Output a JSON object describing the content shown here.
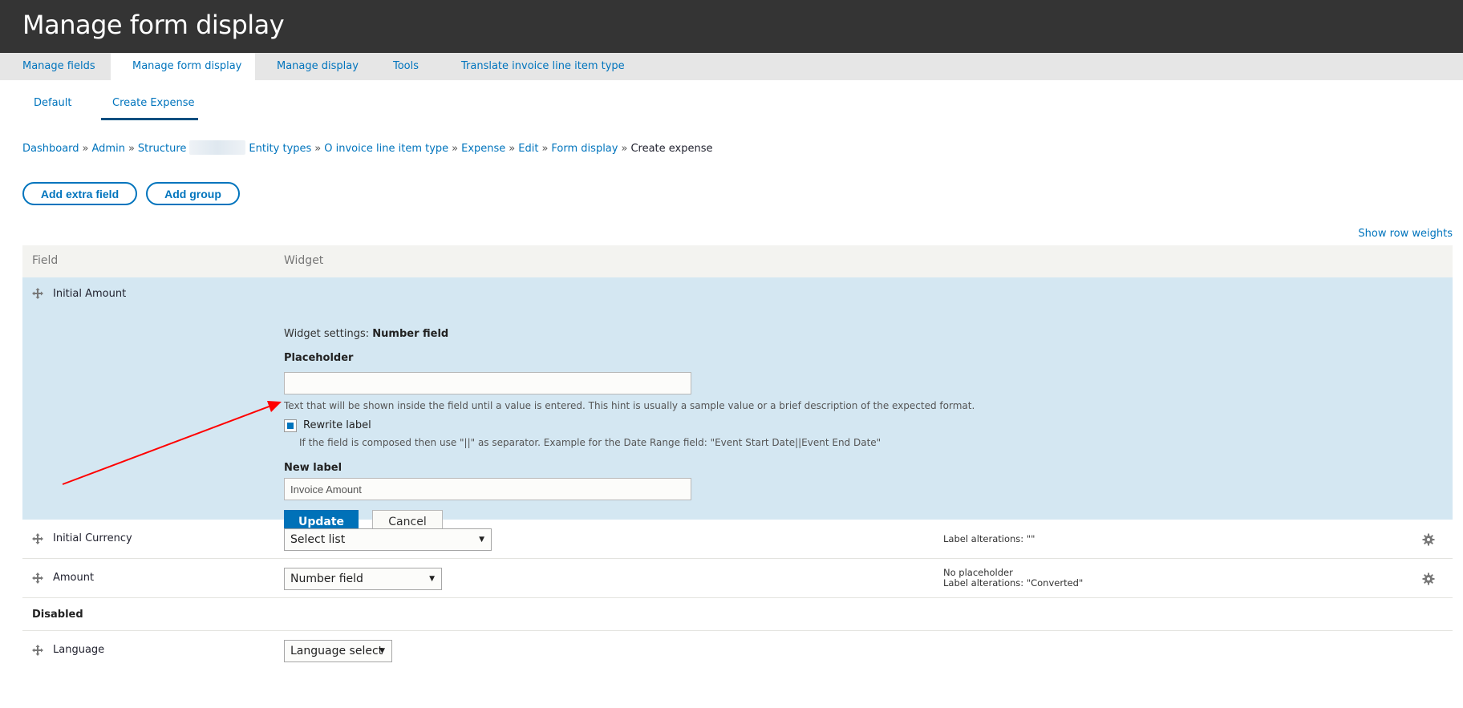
{
  "header": {
    "title": "Manage form display"
  },
  "primary_tabs": [
    {
      "label": "Manage fields",
      "active": false
    },
    {
      "label": "Manage form display",
      "active": true
    },
    {
      "label": "Manage display",
      "active": false
    },
    {
      "label": "Tools",
      "active": false
    },
    {
      "label": "Translate invoice line item type",
      "active": false
    }
  ],
  "secondary_tabs": [
    {
      "label": "Default",
      "active": false
    },
    {
      "label": "Create Expense",
      "active": true
    }
  ],
  "breadcrumb": {
    "items": [
      "Dashboard",
      "Admin",
      "Structure",
      "Entity types",
      "O invoice line item type",
      "Expense",
      "Edit",
      "Form display"
    ],
    "current": "Create expense",
    "separator": "»"
  },
  "actions": {
    "add_extra_field": "Add extra field",
    "add_group": "Add group"
  },
  "show_row_weights": "Show row weights",
  "table": {
    "headers": {
      "field": "Field",
      "widget": "Widget"
    },
    "editing_row": {
      "field": "Initial Amount",
      "widget_settings_prefix": "Widget settings:",
      "widget_settings_type": "Number field",
      "placeholder_label": "Placeholder",
      "placeholder_value": "",
      "placeholder_description": "Text that will be shown inside the field until a value is entered. This hint is usually a sample value or a brief description of the expected format.",
      "rewrite_label": {
        "label": "Rewrite label",
        "checked": true
      },
      "rewrite_description": "If the field is composed then use \"||\" as separator. Example for the Date Range field: \"Event Start Date||Event End Date\"",
      "new_label_label": "New label",
      "new_label_value": "Invoice Amount",
      "update_button": "Update",
      "cancel_button": "Cancel"
    },
    "rows": [
      {
        "field": "Initial Currency",
        "widget": "Select list",
        "summary": [
          "Label alterations: \"\""
        ]
      },
      {
        "field": "Amount",
        "widget": "Number field",
        "summary": [
          "No placeholder",
          "Label alterations: \"Converted\""
        ]
      }
    ],
    "disabled_region": {
      "label": "Disabled"
    },
    "disabled_rows": [
      {
        "field": "Language",
        "widget": "Language select"
      }
    ]
  },
  "annotation": {
    "type": "red-arrow",
    "color": "#ff0000",
    "points_to": "rewrite-label-checkbox"
  },
  "colors": {
    "link": "#0074bd",
    "header_bg": "#343434",
    "edit_row_bg": "#d4e7f2",
    "primary_button": "#0071b8"
  }
}
